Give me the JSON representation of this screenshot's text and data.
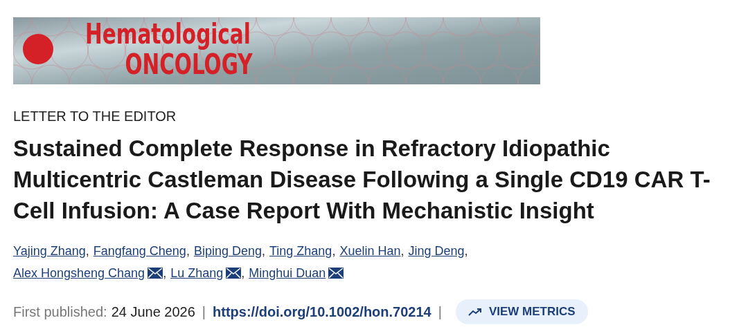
{
  "journal_banner": {
    "logo_line_1": "Hematological",
    "logo_line_2": "ONCOLOGY"
  },
  "article_type": "LETTER TO THE EDITOR",
  "title": "Sustained Complete Response in Refractory Idiopathic Multicentric Castleman Disease Following a Single CD19 CAR T-Cell Infusion: A Case Report With Mechanistic Insight",
  "authors": [
    {
      "name": "Yajing Zhang",
      "corresponding": false,
      "separator": ","
    },
    {
      "name": "Fangfang Cheng",
      "corresponding": false,
      "separator": ","
    },
    {
      "name": "Biping Deng",
      "corresponding": false,
      "separator": ","
    },
    {
      "name": "Ting Zhang",
      "corresponding": false,
      "separator": ","
    },
    {
      "name": "Xuelin Han",
      "corresponding": false,
      "separator": ","
    },
    {
      "name": "Jing Deng",
      "corresponding": false,
      "separator": ","
    },
    {
      "name": "Alex Hongsheng Chang",
      "corresponding": true,
      "separator": ","
    },
    {
      "name": "Lu Zhang",
      "corresponding": true,
      "separator": ","
    },
    {
      "name": "Minghui Duan",
      "corresponding": true
    }
  ],
  "meta": {
    "published_label": "First published:",
    "published_date": "24 June 2026",
    "divider": "|",
    "doi": "https://doi.org/10.1002/hon.70214",
    "divider_2": "|",
    "metrics_button": "VIEW METRICS"
  }
}
